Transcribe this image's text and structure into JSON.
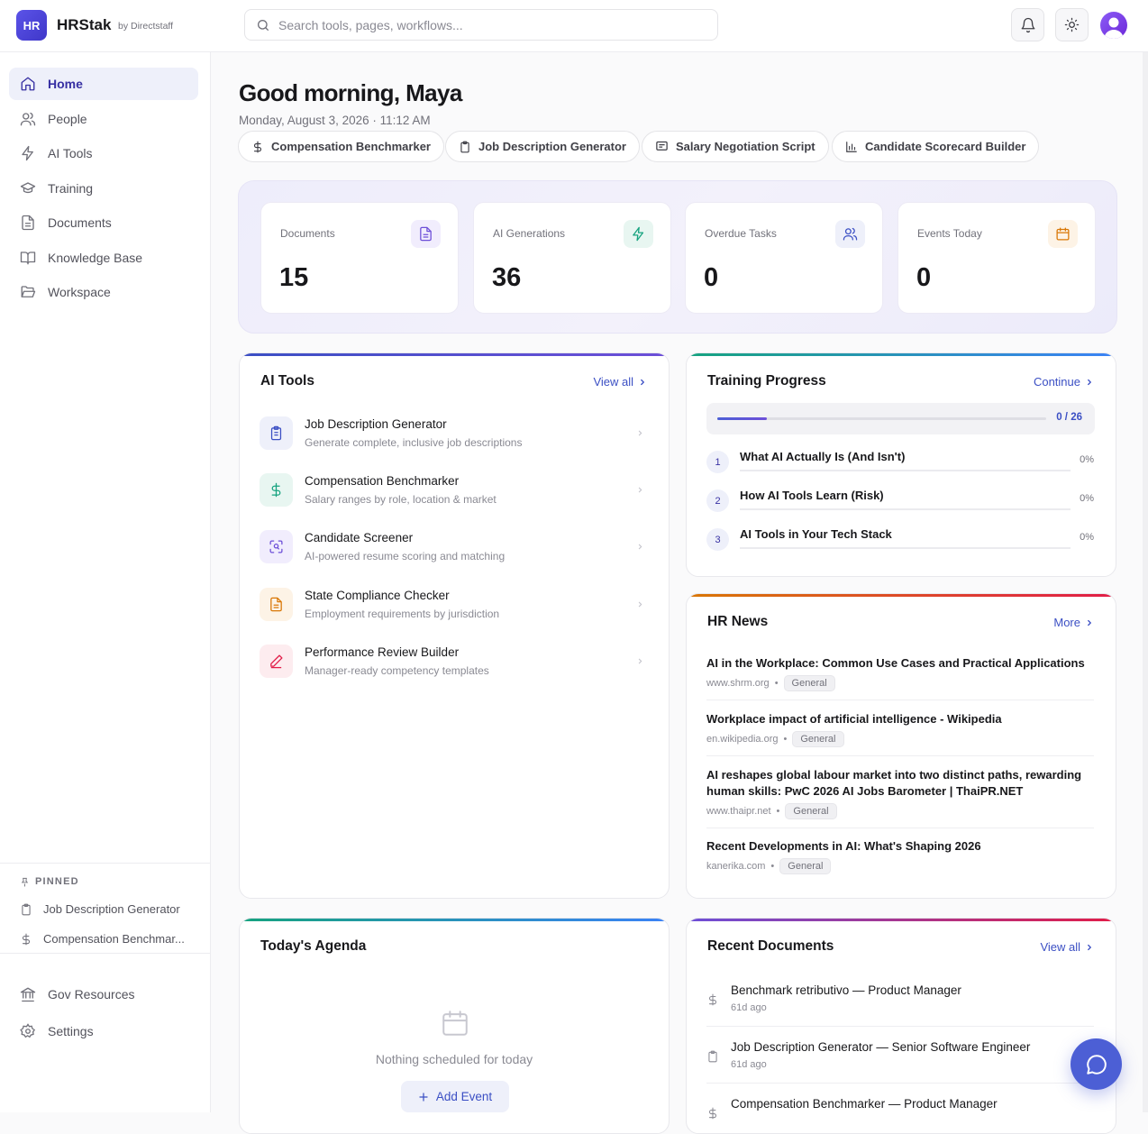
{
  "app": {
    "logo_text": "HR",
    "name": "HRStak",
    "by": "by Directstaff"
  },
  "search": {
    "placeholder": "Search tools, pages, workflows..."
  },
  "header_icons": [
    "bell-icon",
    "sun-icon",
    "user-avatar"
  ],
  "sidebar": {
    "items": [
      {
        "label": "Home",
        "icon": "home-icon",
        "active": true
      },
      {
        "label": "People",
        "icon": "users-icon"
      },
      {
        "label": "AI Tools",
        "icon": "zap-icon"
      },
      {
        "label": "Training",
        "icon": "graduation-cap-icon"
      },
      {
        "label": "Documents",
        "icon": "file-text-icon"
      },
      {
        "label": "Knowledge Base",
        "icon": "book-open-icon"
      },
      {
        "label": "Workspace",
        "icon": "folder-open-icon"
      }
    ],
    "pinned_title": "PINNED",
    "pinned": [
      {
        "label": "Job Description Generator",
        "icon": "clipboard-icon"
      },
      {
        "label": "Compensation Benchmar...",
        "icon": "dollar-icon"
      }
    ],
    "bottom": [
      {
        "label": "Gov Resources",
        "icon": "landmark-icon"
      },
      {
        "label": "Settings",
        "icon": "gear-icon"
      }
    ]
  },
  "greeting": {
    "title": "Good morning, Maya",
    "date": "Monday, August 3, 2026 · 11:12 AM"
  },
  "quick_actions": [
    {
      "label": "Compensation Benchmarker",
      "icon": "dollar-icon"
    },
    {
      "label": "Job Description Generator",
      "icon": "clipboard-icon"
    },
    {
      "label": "Salary Negotiation Script",
      "icon": "message-square-icon"
    },
    {
      "label": "Candidate Scorecard Builder",
      "icon": "bar-chart-icon"
    }
  ],
  "stats": [
    {
      "label": "Documents",
      "value": "15",
      "icon": "file-text-icon",
      "color": "#6d4fd8"
    },
    {
      "label": "AI Generations",
      "value": "36",
      "icon": "zap-icon",
      "color": "#16a37f"
    },
    {
      "label": "Overdue Tasks",
      "value": "0",
      "icon": "users-icon",
      "color": "#3b4fc4"
    },
    {
      "label": "Events Today",
      "value": "0",
      "icon": "calendar-icon",
      "color": "#d97706"
    }
  ],
  "ai_tools": {
    "title": "AI Tools",
    "link": "View all",
    "items": [
      {
        "name": "Job Description Generator",
        "desc": "Generate complete, inclusive job descriptions",
        "icon": "clipboard-icon",
        "color": "#3b4fc4"
      },
      {
        "name": "Compensation Benchmarker",
        "desc": "Salary ranges by role, location & market",
        "icon": "dollar-icon",
        "color": "#16a37f"
      },
      {
        "name": "Candidate Screener",
        "desc": "AI-powered resume scoring and matching",
        "icon": "scan-face-icon",
        "color": "#6d4fd8"
      },
      {
        "name": "State Compliance Checker",
        "desc": "Employment requirements by jurisdiction",
        "icon": "file-text-icon",
        "color": "#d97706"
      },
      {
        "name": "Performance Review Builder",
        "desc": "Manager-ready competency templates",
        "icon": "pen-icon",
        "color": "#e11d48"
      }
    ]
  },
  "training": {
    "title": "Training Progress",
    "link": "Continue",
    "progress_text": "0 / 26",
    "progress_fraction": 0.15,
    "lessons": [
      {
        "num": "1",
        "title": "What AI Actually Is (And Isn't)",
        "pct": "0%"
      },
      {
        "num": "2",
        "title": "How AI Tools Learn (Risk)",
        "pct": "0%"
      },
      {
        "num": "3",
        "title": "AI Tools in Your Tech Stack",
        "pct": "0%"
      }
    ]
  },
  "news": {
    "title": "HR News",
    "link": "More",
    "items": [
      {
        "title": "AI in the Workplace: Common Use Cases and Practical Applications",
        "source": "www.shrm.org",
        "tag": "General"
      },
      {
        "title": "Workplace impact of artificial intelligence - Wikipedia",
        "source": "en.wikipedia.org",
        "tag": "General"
      },
      {
        "title": "AI reshapes global labour market into two distinct paths, rewarding human skills: PwC 2026 AI Jobs Barometer | ThaiPR.NET",
        "source": "www.thaipr.net",
        "tag": "General"
      },
      {
        "title": "Recent Developments in AI: What's Shaping 2026",
        "source": "kanerika.com",
        "tag": "General"
      }
    ]
  },
  "agenda": {
    "title": "Today's Agenda",
    "empty": "Nothing scheduled for today",
    "button": "Add Event"
  },
  "recent_docs": {
    "title": "Recent Documents",
    "link": "View all",
    "items": [
      {
        "title": "Benchmark retributivo — Product Manager",
        "age": "61d ago",
        "icon": "dollar-icon"
      },
      {
        "title": "Job Description Generator — Senior Software Engineer",
        "age": "61d ago",
        "icon": "clipboard-icon"
      },
      {
        "title": "Compensation Benchmarker — Product Manager",
        "age": "",
        "icon": "dollar-icon"
      }
    ]
  },
  "fab": {
    "icon": "chat-bubble-icon"
  }
}
